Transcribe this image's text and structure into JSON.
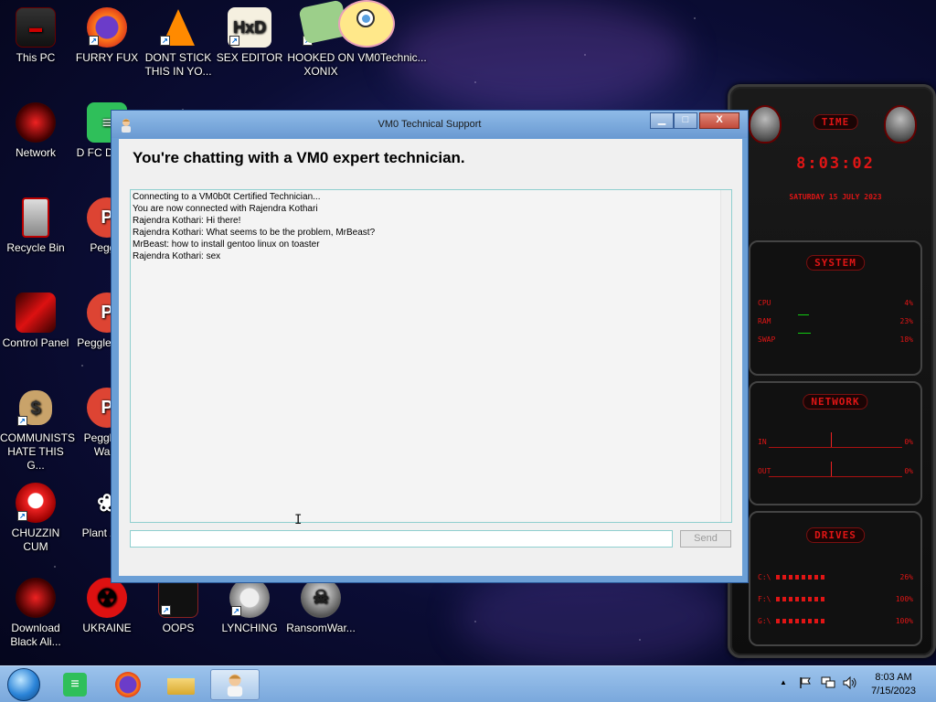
{
  "desktop": {
    "icons": [
      {
        "label": "This PC"
      },
      {
        "label": "FURRY FUX"
      },
      {
        "label": "DONT STICK THIS IN YO..."
      },
      {
        "label": "SEX EDITOR"
      },
      {
        "label": "HOOKED ON XONIX"
      },
      {
        "label": "VM0Technic..."
      },
      {
        "label": "Network"
      },
      {
        "label": "D FC DUMB"
      },
      {
        "label": "Recycle Bin"
      },
      {
        "label": "Peggle"
      },
      {
        "label": "Control Panel"
      },
      {
        "label": "Peggle Delu"
      },
      {
        "label": "COMMUNISTS HATE THIS G..."
      },
      {
        "label": "Peggle of Ward"
      },
      {
        "label": "CHUZZIN CUM"
      },
      {
        "label": "Plant Zom"
      },
      {
        "label": "Download Black Ali..."
      },
      {
        "label": "UKRAINE"
      },
      {
        "label": "OOPS"
      },
      {
        "label": "LYNCHING"
      },
      {
        "label": "RansomWar..."
      }
    ]
  },
  "widget": {
    "time_header": "TIME",
    "time_value": "8:03:02",
    "date_value": "SATURDAY 15 JULY 2023",
    "system_header": "SYSTEM",
    "system_rows": [
      {
        "label": "CPU",
        "value": "4%"
      },
      {
        "label": "RAM",
        "value": "23%"
      },
      {
        "label": "SWAP",
        "value": "18%"
      }
    ],
    "network_header": "NETWORK",
    "network_rows": [
      {
        "label": "IN",
        "value": "0%"
      },
      {
        "label": "OUT",
        "value": "0%"
      }
    ],
    "drives_header": "DRIVES",
    "drive_rows": [
      {
        "label": "C:\\",
        "value": "26%"
      },
      {
        "label": "F:\\",
        "value": "100%"
      },
      {
        "label": "G:\\",
        "value": "100%"
      }
    ]
  },
  "chat_window": {
    "title": "VM0 Technical Support",
    "heading": "You're chatting with a VM0 expert technician.",
    "messages": [
      "Connecting to a VM0b0t Certified Technician...",
      "You are now connected with Rajendra Kothari",
      "Rajendra Kothari: Hi there!",
      "Rajendra Kothari: What seems to be the problem, MrBeast?",
      "MrBeast: how to install gentoo linux on toaster",
      "Rajendra Kothari: sex"
    ],
    "input_value": "",
    "send_label": "Send",
    "minimize_glyph": "▁",
    "maximize_glyph": "□",
    "close_glyph": "X"
  },
  "taskbar": {
    "time": "8:03 AM",
    "date": "7/15/2023",
    "tray_arrow": "▲"
  },
  "colors": {
    "widget_red": "#e01515",
    "window_frame": "#6b9fd6",
    "taskbar": "#8bb6e4"
  }
}
